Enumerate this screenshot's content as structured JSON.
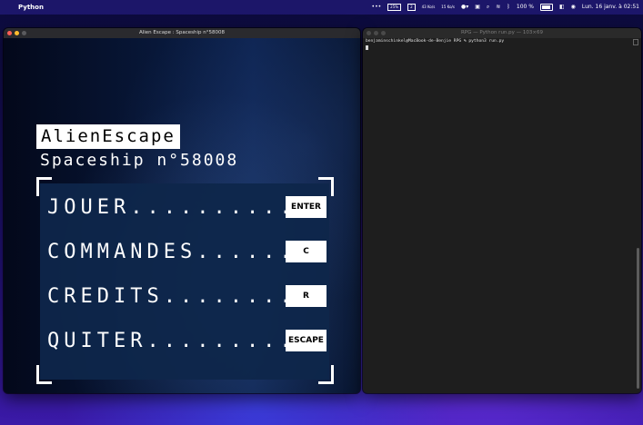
{
  "menubar": {
    "app_name": "Python",
    "memory_label": "25%",
    "battery_small": "2",
    "network_up": "43 Ko/s",
    "network_down": "15 Ko/s",
    "battery_percent": "100 %",
    "datetime": "Lun. 16 janv. à 02:51"
  },
  "game_window": {
    "title": "Alien Escape : Spaceship n°58008",
    "logo": "AlienEscape",
    "subtitle": "Spaceship n°58008",
    "menu": [
      {
        "label": "JOUER............",
        "key": "ENTER"
      },
      {
        "label": "COMMANDES........",
        "key": "C"
      },
      {
        "label": "CREDITS.........",
        "key": "R"
      },
      {
        "label": "QUITER..........",
        "key": "ESCAPE"
      }
    ]
  },
  "terminal": {
    "title": "RPG — Python run.py — 103×69",
    "prompt_line": "benjaminschinkel@MacBook-de-Benjie RPG % python3 run.py"
  },
  "colors": {
    "desktop_accent": "#3a3bd8",
    "panel": "#0e264a",
    "traffic_red": "#ff5f57",
    "traffic_yellow": "#febc2e"
  }
}
